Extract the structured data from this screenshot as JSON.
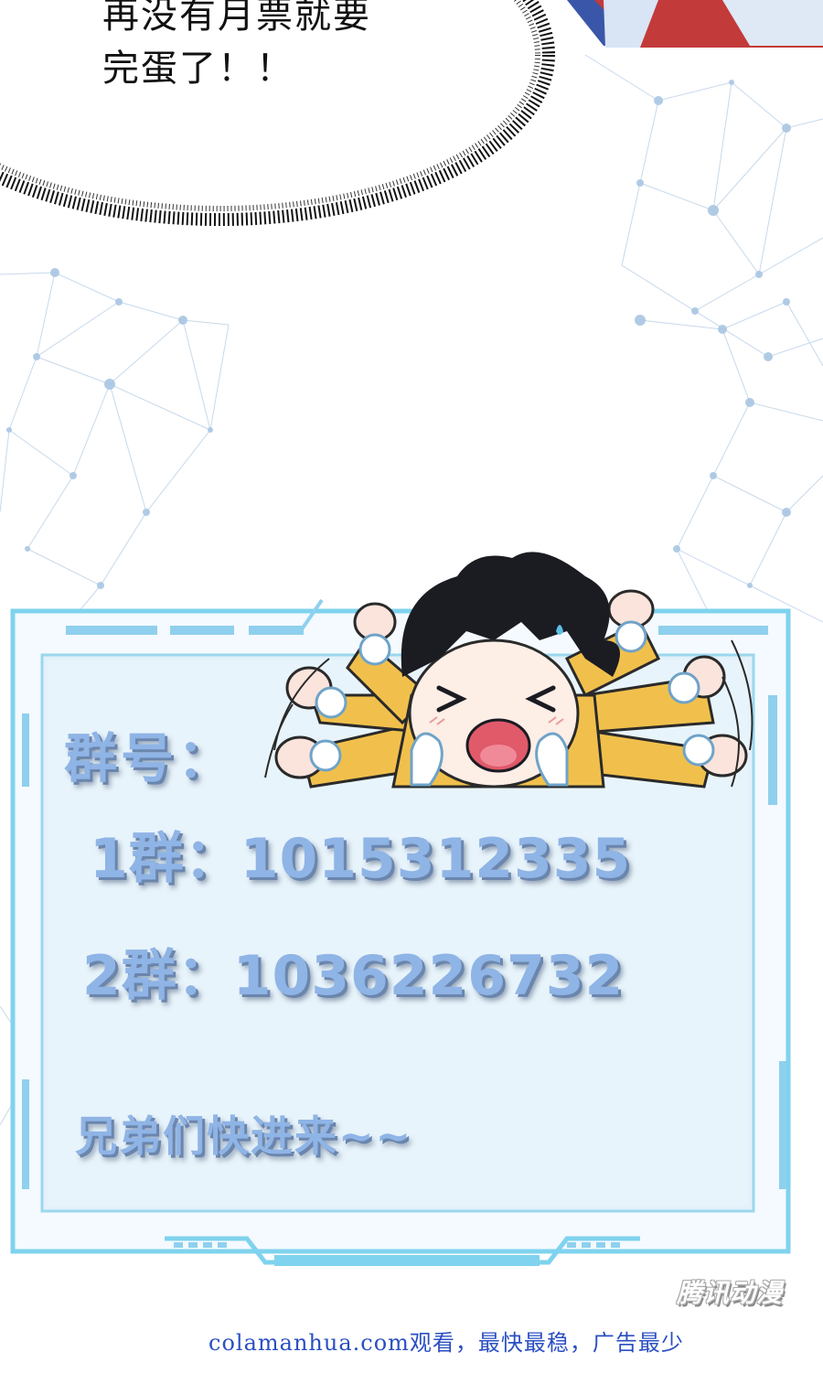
{
  "speech_bubble": {
    "lines": [
      "再没有月票就要",
      "完蛋了！！"
    ]
  },
  "info_panel": {
    "label": "群号：",
    "groups": [
      {
        "text": "1群：1015312335"
      },
      {
        "text": "2群：1036226732"
      }
    ],
    "call_to_action": "兄弟们快进来~~"
  },
  "footer": {
    "text": "colamanhua.com观看，最快最稳，广告最少",
    "logo_text": "腾讯动漫"
  },
  "colors": {
    "panel_border": "#7fd3ee",
    "panel_fill": "#e6f3fb",
    "panel_text": "#8fb4e6",
    "footer_text": "#2b4fc2",
    "character_hair": "#1b1b22",
    "character_robe": "#f1c04c"
  }
}
